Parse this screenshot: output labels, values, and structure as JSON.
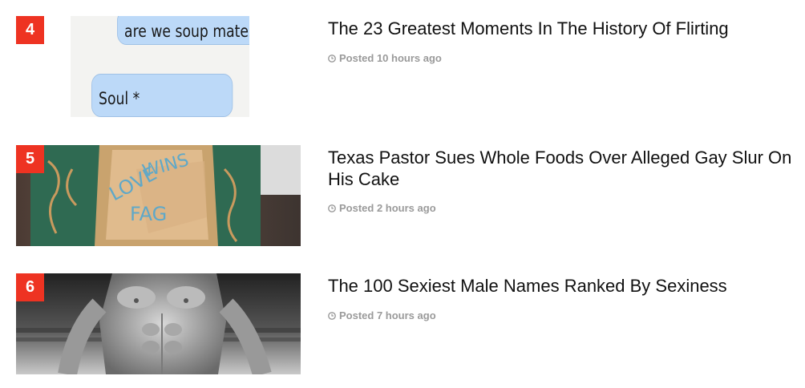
{
  "items": [
    {
      "rank": "4",
      "title": "The 23 Greatest Moments In The History Of Flirting",
      "posted": "Posted 10 hours ago",
      "thumb_text": [
        "are we soup mates",
        "Soul *"
      ]
    },
    {
      "rank": "5",
      "title": "Texas Pastor Sues Whole Foods Over Alleged Gay Slur On His Cake",
      "posted": "Posted 2 hours ago",
      "thumb_text": [
        "LOVE WINS",
        "FAG"
      ]
    },
    {
      "rank": "6",
      "title": "The 100 Sexiest Male Names Ranked By Sexiness",
      "posted": "Posted 7 hours ago"
    }
  ],
  "colors": {
    "rank_badge": "#ee3322",
    "title": "#111111",
    "meta": "#9a9a9a"
  },
  "icons": {
    "meta": "clock-icon"
  }
}
